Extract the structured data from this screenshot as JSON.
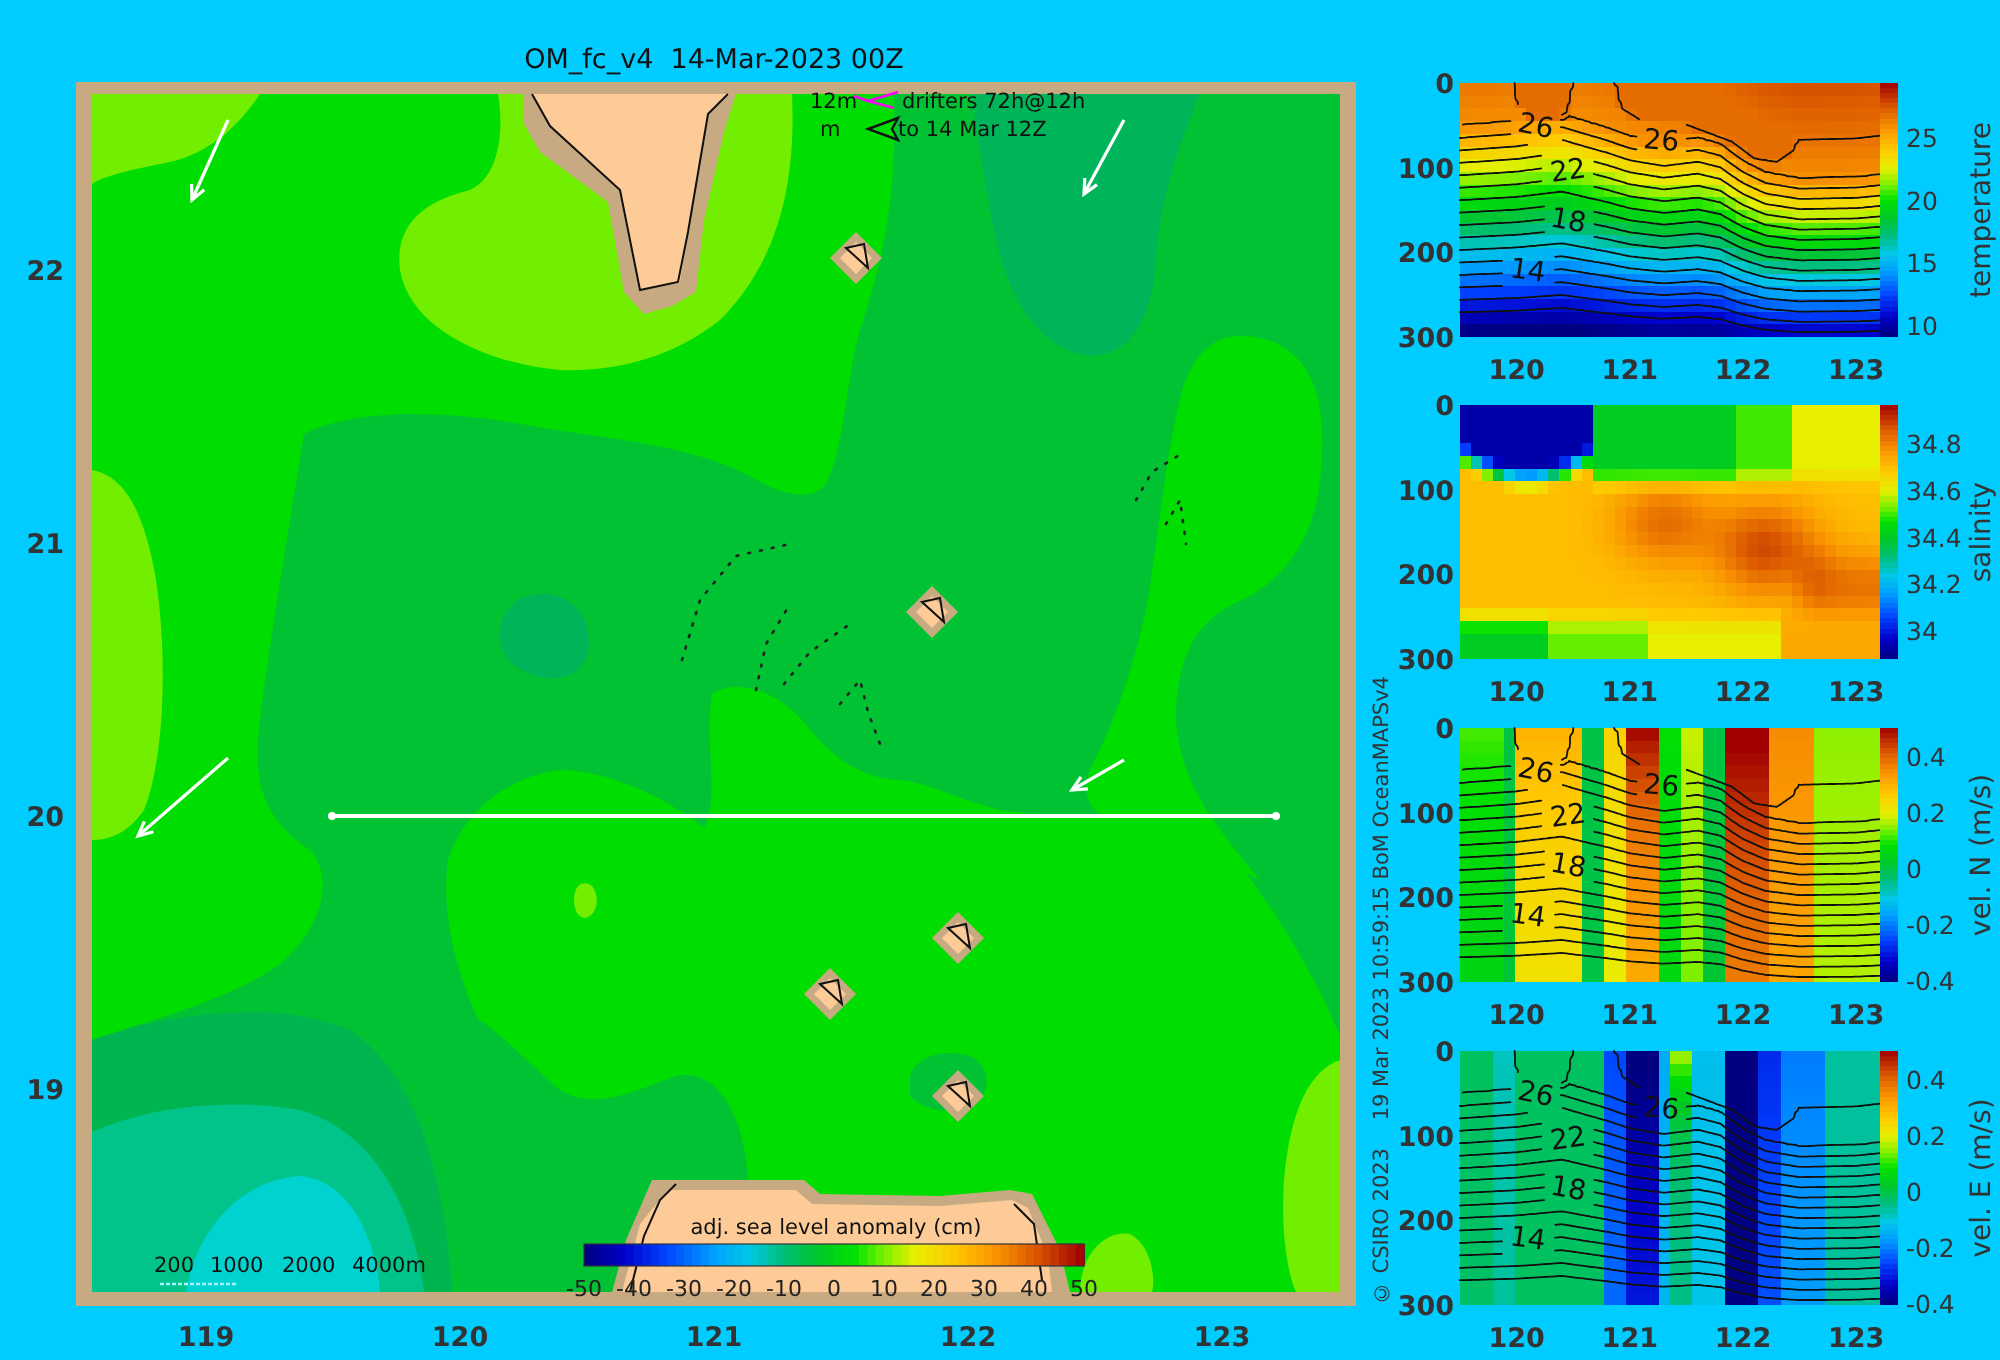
{
  "title": "OM_fc_v4  14-Mar-2023 00Z",
  "map": {
    "y_ticks": [
      "22",
      "21",
      "20",
      "19"
    ],
    "x_ticks": [
      "119",
      "120",
      "121",
      "122",
      "123"
    ],
    "drifter_legend": [
      {
        "kind": "track",
        "depth": "12m",
        "text": "drifters 72h@12h"
      },
      {
        "kind": "end",
        "depth": "m",
        "text": "to 14 Mar 12Z"
      }
    ],
    "depth_legend": [
      "200",
      "1000",
      "2000",
      "4000m"
    ],
    "colorbar": {
      "label": "adj. sea level anomaly (cm)",
      "ticks": [
        "-50",
        "-40",
        "-30",
        "-20",
        "-10",
        "0",
        "10",
        "20",
        "30",
        "40",
        "50"
      ]
    }
  },
  "credits": [
    "© CSIRO 2023",
    "19 Mar 2023 10:59:15 BoM OceanMAPSv4"
  ],
  "sections": [
    {
      "kind": "temperature",
      "label": "temperature",
      "y_ticks": [
        "0",
        "100",
        "200",
        "300"
      ],
      "x_ticks": [
        "120",
        "121",
        "122",
        "123"
      ],
      "colorbar_ticks": [
        "25",
        "20",
        "15",
        "10"
      ],
      "contour_labels": [
        "26",
        "26",
        "22",
        "18",
        "14"
      ]
    },
    {
      "kind": "salinity",
      "label": "salinity",
      "y_ticks": [
        "0",
        "100",
        "200",
        "300"
      ],
      "x_ticks": [
        "120",
        "121",
        "122",
        "123"
      ],
      "colorbar_ticks": [
        "34.8",
        "34.6",
        "34.4",
        "34.2",
        "34"
      ]
    },
    {
      "kind": "velocity_north",
      "label": "vel. N (m/s)",
      "y_ticks": [
        "0",
        "100",
        "200",
        "300"
      ],
      "x_ticks": [
        "120",
        "121",
        "122",
        "123"
      ],
      "colorbar_ticks": [
        "0.4",
        "0.2",
        "0",
        "-0.2",
        "-0.4"
      ],
      "contour_labels": [
        "26",
        "26",
        "22",
        "18",
        "14"
      ]
    },
    {
      "kind": "velocity_east",
      "label": "vel. E (m/s)",
      "y_ticks": [
        "0",
        "100",
        "200",
        "300"
      ],
      "x_ticks": [
        "120",
        "121",
        "122",
        "123"
      ],
      "colorbar_ticks": [
        "0.4",
        "0.2",
        "0",
        "-0.2",
        "-0.4"
      ],
      "contour_labels": [
        "26",
        "26",
        "22",
        "18",
        "14"
      ]
    }
  ]
}
